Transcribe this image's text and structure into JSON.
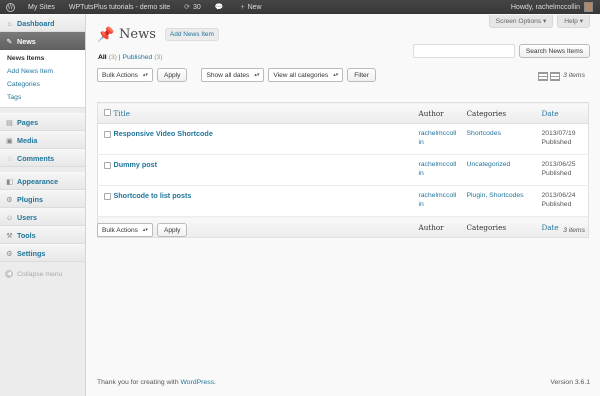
{
  "adminbar": {
    "my_sites": "My Sites",
    "site_name": "WPTutsPlus tutorials - demo site",
    "updates_count": "30",
    "new_label": "New",
    "howdy": "Howdy, rachelmccollin"
  },
  "sidebar": {
    "dashboard": "Dashboard",
    "news": "News",
    "news_sub": [
      "News Items",
      "Add News Item",
      "Categories",
      "Tags"
    ],
    "pages": "Pages",
    "media": "Media",
    "comments": "Comments",
    "appearance": "Appearance",
    "plugins": "Plugins",
    "users": "Users",
    "tools": "Tools",
    "settings": "Settings",
    "collapse": "Collapse menu"
  },
  "screen": {
    "options": "Screen Options",
    "help": "Help"
  },
  "page": {
    "title": "News",
    "add_new": "Add News Item"
  },
  "filters": {
    "all": "All",
    "all_count": "(3)",
    "separator": "|",
    "published": "Published",
    "published_count": "(3)"
  },
  "search": {
    "button": "Search News Items",
    "value": ""
  },
  "tablenav_top": {
    "bulk": "Bulk Actions",
    "apply": "Apply",
    "dates": "Show all dates",
    "categories": "View all categories",
    "filter": "Filter",
    "count": "3 items"
  },
  "table": {
    "headers": {
      "title": "Title",
      "author": "Author",
      "categories": "Categories",
      "date": "Date"
    },
    "rows": [
      {
        "title": "Responsive Video Shortcode",
        "author_1": "rachelmccoll",
        "author_2": "in",
        "categories": "Shortcodes",
        "date": "2013/07/19",
        "status": "Published"
      },
      {
        "title": "Dummy post",
        "author_1": "rachelmccoll",
        "author_2": "in",
        "categories": "Uncategorized",
        "date": "2013/06/25",
        "status": "Published"
      },
      {
        "title": "Shortcode to list posts",
        "author_1": "rachelmccoll",
        "author_2": "in",
        "categories": "Plugin, Shortcodes",
        "date": "2013/06/24",
        "status": "Published"
      }
    ]
  },
  "tablenav_bottom": {
    "bulk": "Bulk Actions",
    "apply": "Apply",
    "count": "3 items"
  },
  "footer": {
    "thanks": "Thank you for creating with ",
    "wp_link": "WordPress",
    "period": ".",
    "version": "Version 3.6.1"
  }
}
